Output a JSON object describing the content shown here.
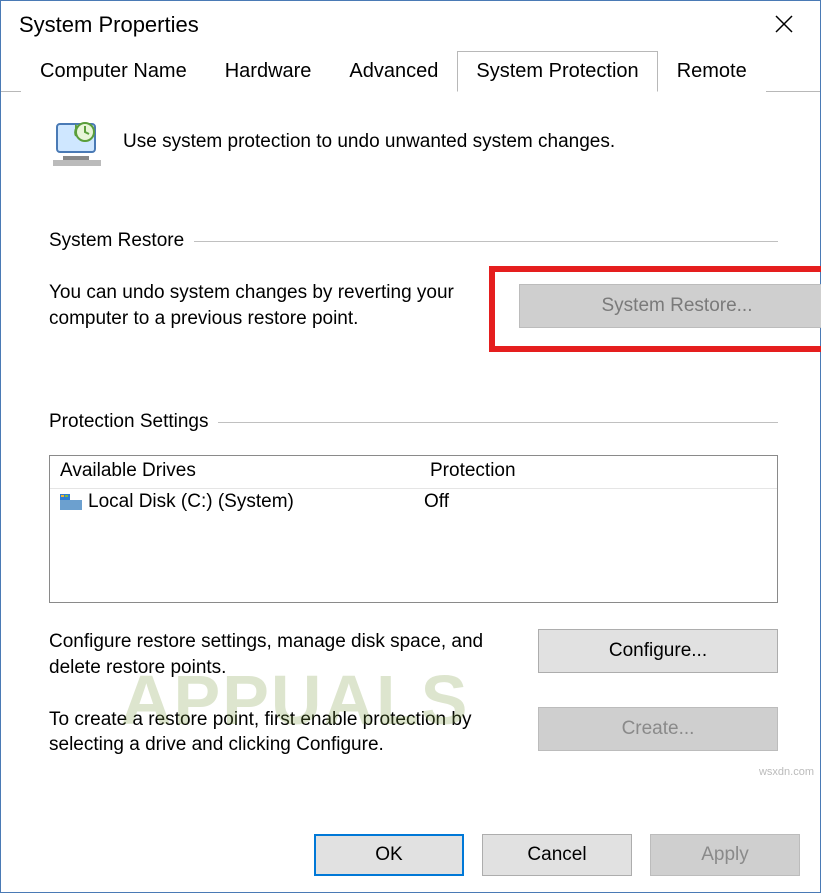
{
  "window": {
    "title": "System Properties"
  },
  "tabs": [
    {
      "label": "Computer Name"
    },
    {
      "label": "Hardware"
    },
    {
      "label": "Advanced"
    },
    {
      "label": "System Protection",
      "active": true
    },
    {
      "label": "Remote"
    }
  ],
  "intro": "Use system protection to undo unwanted system changes.",
  "restore_section": {
    "title": "System Restore",
    "text": "You can undo system changes by reverting your computer to a previous restore point.",
    "button": "System Restore..."
  },
  "protection_section": {
    "title": "Protection Settings",
    "columns": {
      "drive": "Available Drives",
      "protection": "Protection"
    },
    "rows": [
      {
        "name": "Local Disk (C:) (System)",
        "status": "Off"
      }
    ],
    "configure_text": "Configure restore settings, manage disk space, and delete restore points.",
    "configure_btn": "Configure...",
    "create_text": "To create a restore point, first enable protection by selecting a drive and clicking Configure.",
    "create_btn": "Create..."
  },
  "footer": {
    "ok": "OK",
    "cancel": "Cancel",
    "apply": "Apply"
  },
  "watermark": "APPUALS",
  "attribution": "wsxdn.com"
}
